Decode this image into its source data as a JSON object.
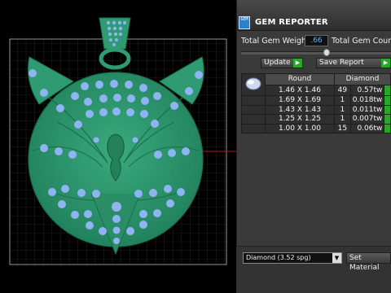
{
  "panel": {
    "app_icon_text": "GEM",
    "title": "GEM REPORTER",
    "total_weight_label": "Total Gem Weight",
    "total_weight_value": ".66",
    "total_count_label": "Total Gem Count",
    "update_label": "Update",
    "save_report_label": "Save Report",
    "table": {
      "headers": [
        "Round",
        "Diamond"
      ],
      "rows": [
        {
          "size": "1.46 X 1.46",
          "count": "49",
          "carat": "0.57tw"
        },
        {
          "size": "1.69 X 1.69",
          "count": "1",
          "carat": "0.018tw"
        },
        {
          "size": "1.43 X 1.43",
          "count": "1",
          "carat": "0.011tw"
        },
        {
          "size": "1.25 X 1.25",
          "count": "1",
          "carat": "0.007tw"
        },
        {
          "size": "1.00 X 1.00",
          "count": "15",
          "carat": "0.06tw"
        }
      ]
    },
    "material_select": "Diamond     (3.52 spg)",
    "set_material_label": "Set Material"
  },
  "colors": {
    "model": "#2f9b72",
    "model_dark": "#1a6e4e",
    "gem": "#8fb4f2",
    "grid": "#5a5a5a",
    "accent_green": "#2aa62a"
  },
  "icons": {
    "dropdown": "chevron-down-icon",
    "arrow": "play-arrow-icon"
  }
}
